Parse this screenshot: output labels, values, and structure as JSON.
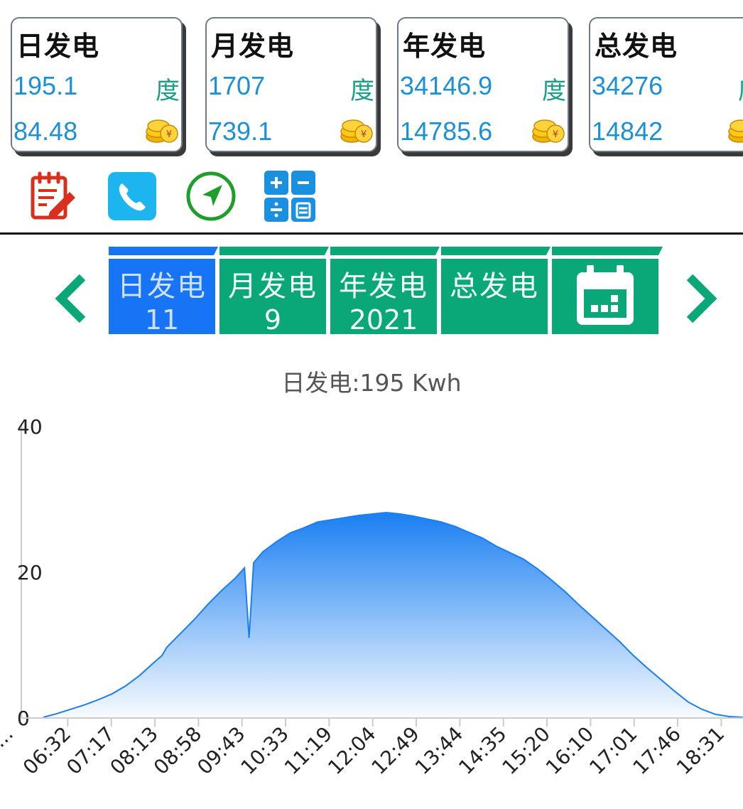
{
  "cards": [
    {
      "title": "日发电",
      "energy": "195.1",
      "unit": "度",
      "money": "84.48"
    },
    {
      "title": "月发电",
      "energy": "1707",
      "unit": "度",
      "money": "739.1"
    },
    {
      "title": "年发电",
      "energy": "34146.9",
      "unit": "度",
      "money": "14785.6"
    },
    {
      "title": "总发电",
      "energy": "34276",
      "unit": "度",
      "money": "14842"
    }
  ],
  "icons": [
    "edit-note-icon",
    "phone-icon",
    "navigation-icon",
    "calculator-icon"
  ],
  "tabs": [
    {
      "label": "日发电",
      "value": "11",
      "active": true
    },
    {
      "label": "月发电",
      "value": "9",
      "active": false
    },
    {
      "label": "年发电",
      "value": "2021",
      "active": false
    },
    {
      "label": "总发电",
      "value": "",
      "active": false
    }
  ],
  "colors": {
    "tab_active": "#1774f5",
    "tab": "#0aa879",
    "value_blue": "#1a90d6",
    "unit_green": "#17a086",
    "area": "#1a7ff2"
  },
  "chart_data": {
    "type": "area",
    "title": "日发电:195 Kwh",
    "y_ticks": [
      0,
      20,
      40
    ],
    "ylim": [
      0,
      40
    ],
    "x_tick_labels": [
      "...",
      "06:32",
      "07:17",
      "08:13",
      "08:58",
      "09:43",
      "10:33",
      "11:19",
      "12:04",
      "12:49",
      "13:44",
      "14:35",
      "15:20",
      "16:10",
      "17:01",
      "17:46",
      "18:31"
    ],
    "x": [
      "06:00",
      "06:15",
      "06:30",
      "06:45",
      "07:00",
      "07:15",
      "07:30",
      "07:45",
      "08:00",
      "08:10",
      "08:15",
      "08:30",
      "08:45",
      "09:00",
      "09:15",
      "09:30",
      "09:40",
      "09:45",
      "09:50",
      "10:00",
      "10:15",
      "10:30",
      "10:45",
      "11:00",
      "11:15",
      "11:30",
      "11:45",
      "12:00",
      "12:15",
      "12:30",
      "12:45",
      "13:00",
      "13:15",
      "13:30",
      "13:45",
      "14:00",
      "14:15",
      "14:30",
      "14:45",
      "15:00",
      "15:15",
      "15:30",
      "15:45",
      "16:00",
      "16:15",
      "16:30",
      "16:45",
      "17:00",
      "17:15",
      "17:30",
      "17:45",
      "18:00",
      "18:15",
      "18:30",
      "18:45"
    ],
    "values": [
      0.1,
      0.6,
      1.2,
      1.8,
      2.5,
      3.3,
      4.4,
      5.8,
      7.5,
      8.6,
      9.7,
      11.6,
      13.5,
      15.6,
      17.5,
      19.2,
      20.6,
      11.0,
      21.3,
      22.8,
      24.2,
      25.4,
      26.1,
      26.9,
      27.2,
      27.5,
      27.8,
      28.0,
      28.2,
      28.0,
      27.7,
      27.3,
      26.9,
      26.3,
      25.5,
      24.7,
      23.6,
      22.7,
      21.8,
      20.5,
      19.0,
      17.4,
      15.6,
      13.9,
      12.2,
      10.5,
      8.6,
      6.9,
      5.3,
      3.7,
      2.2,
      1.2,
      0.5,
      0.2,
      0.1
    ]
  }
}
